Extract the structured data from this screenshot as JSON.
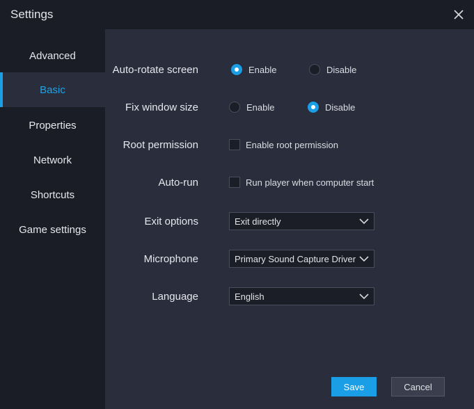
{
  "window": {
    "title": "Settings",
    "close_icon": "close-icon"
  },
  "sidebar": {
    "items": [
      {
        "label": "Advanced"
      },
      {
        "label": "Basic",
        "active": true
      },
      {
        "label": "Properties"
      },
      {
        "label": "Network"
      },
      {
        "label": "Shortcuts"
      },
      {
        "label": "Game settings"
      }
    ]
  },
  "settings": {
    "auto_rotate": {
      "label": "Auto-rotate screen",
      "enable": "Enable",
      "disable": "Disable",
      "selected": "Enable"
    },
    "fix_window": {
      "label": "Fix window size",
      "enable": "Enable",
      "disable": "Disable",
      "selected": "Disable"
    },
    "root_permission": {
      "label": "Root permission",
      "checkbox_label": "Enable root permission",
      "checked": false
    },
    "auto_run": {
      "label": "Auto-run",
      "checkbox_label": "Run player when computer start",
      "checked": false
    },
    "exit_options": {
      "label": "Exit options",
      "value": "Exit directly"
    },
    "microphone": {
      "label": "Microphone",
      "value": "Primary Sound Capture Driver"
    },
    "language": {
      "label": "Language",
      "value": "English"
    }
  },
  "footer": {
    "save_label": "Save",
    "cancel_label": "Cancel"
  },
  "colors": {
    "accent": "#1a9ee6",
    "background": "#1b1d26",
    "panel": "#2a2d3c"
  }
}
